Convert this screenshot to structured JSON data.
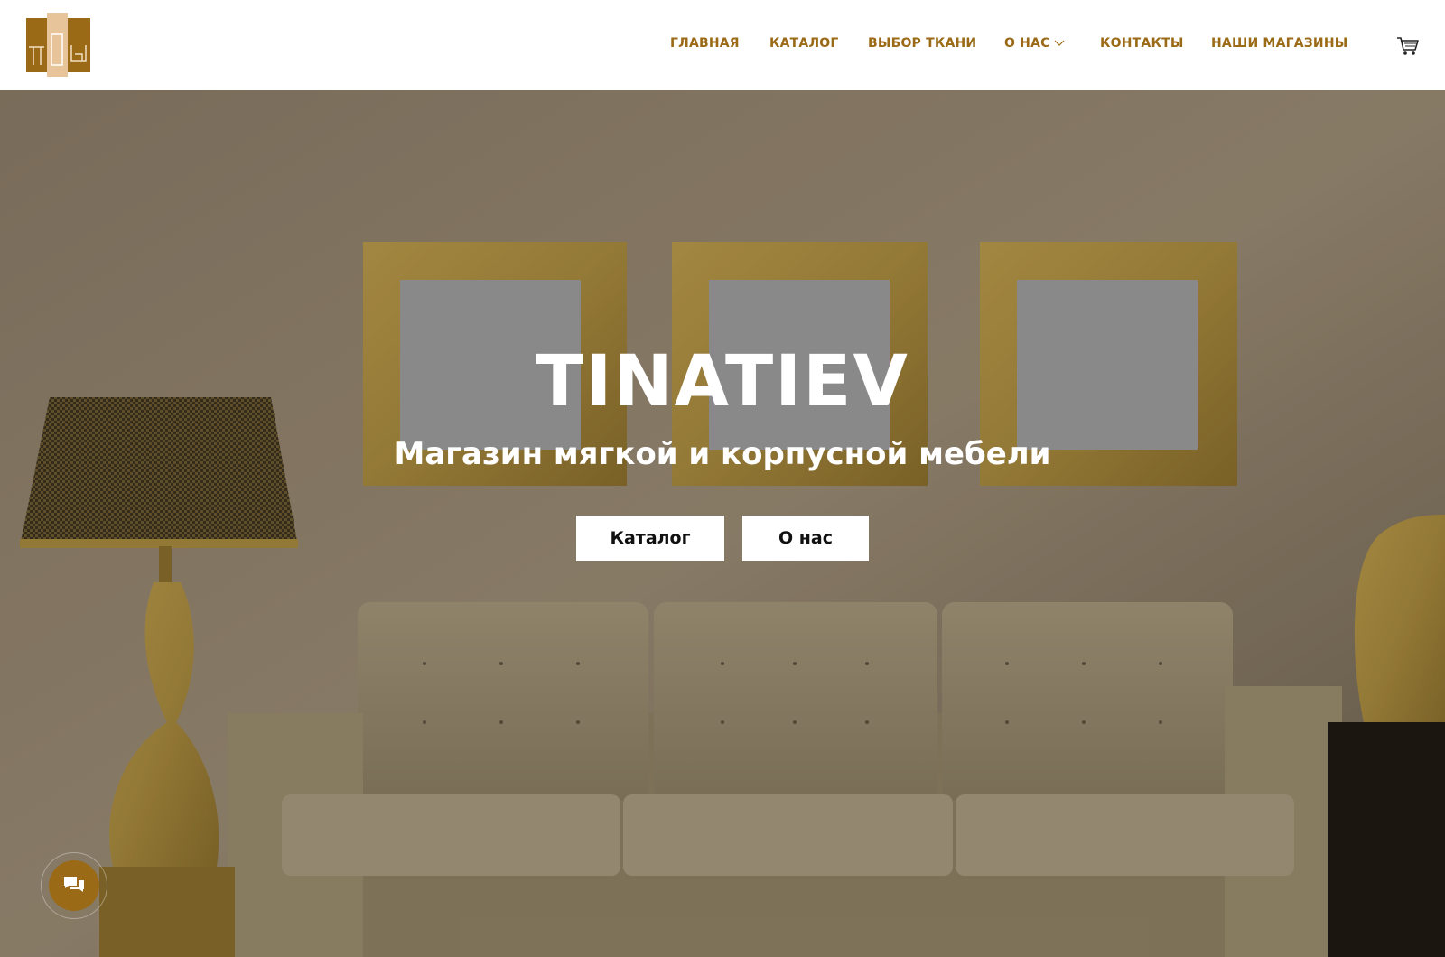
{
  "nav": {
    "items": [
      {
        "label": "ГЛАВНАЯ"
      },
      {
        "label": "КАТАЛОГ"
      },
      {
        "label": "ВЫБОР ТКАНИ"
      },
      {
        "label": "О НАС"
      },
      {
        "label": "КОНТАКТЫ"
      },
      {
        "label": "НАШИ МАГАЗИНЫ"
      }
    ]
  },
  "icons": {
    "logo": "logo-icon",
    "cart": "cart-icon",
    "dropdown": "chevron-down-icon",
    "chat": "chat-icon"
  },
  "hero": {
    "title": "TINATIEV",
    "subtitle": "Магазин мягкой и корпусной мебели",
    "buttons": {
      "catalog": "Каталог",
      "about": "О нас"
    }
  },
  "colors": {
    "accent": "#9a6a16",
    "logo_light": "#e7c49a",
    "button_bg": "#ffffff"
  }
}
